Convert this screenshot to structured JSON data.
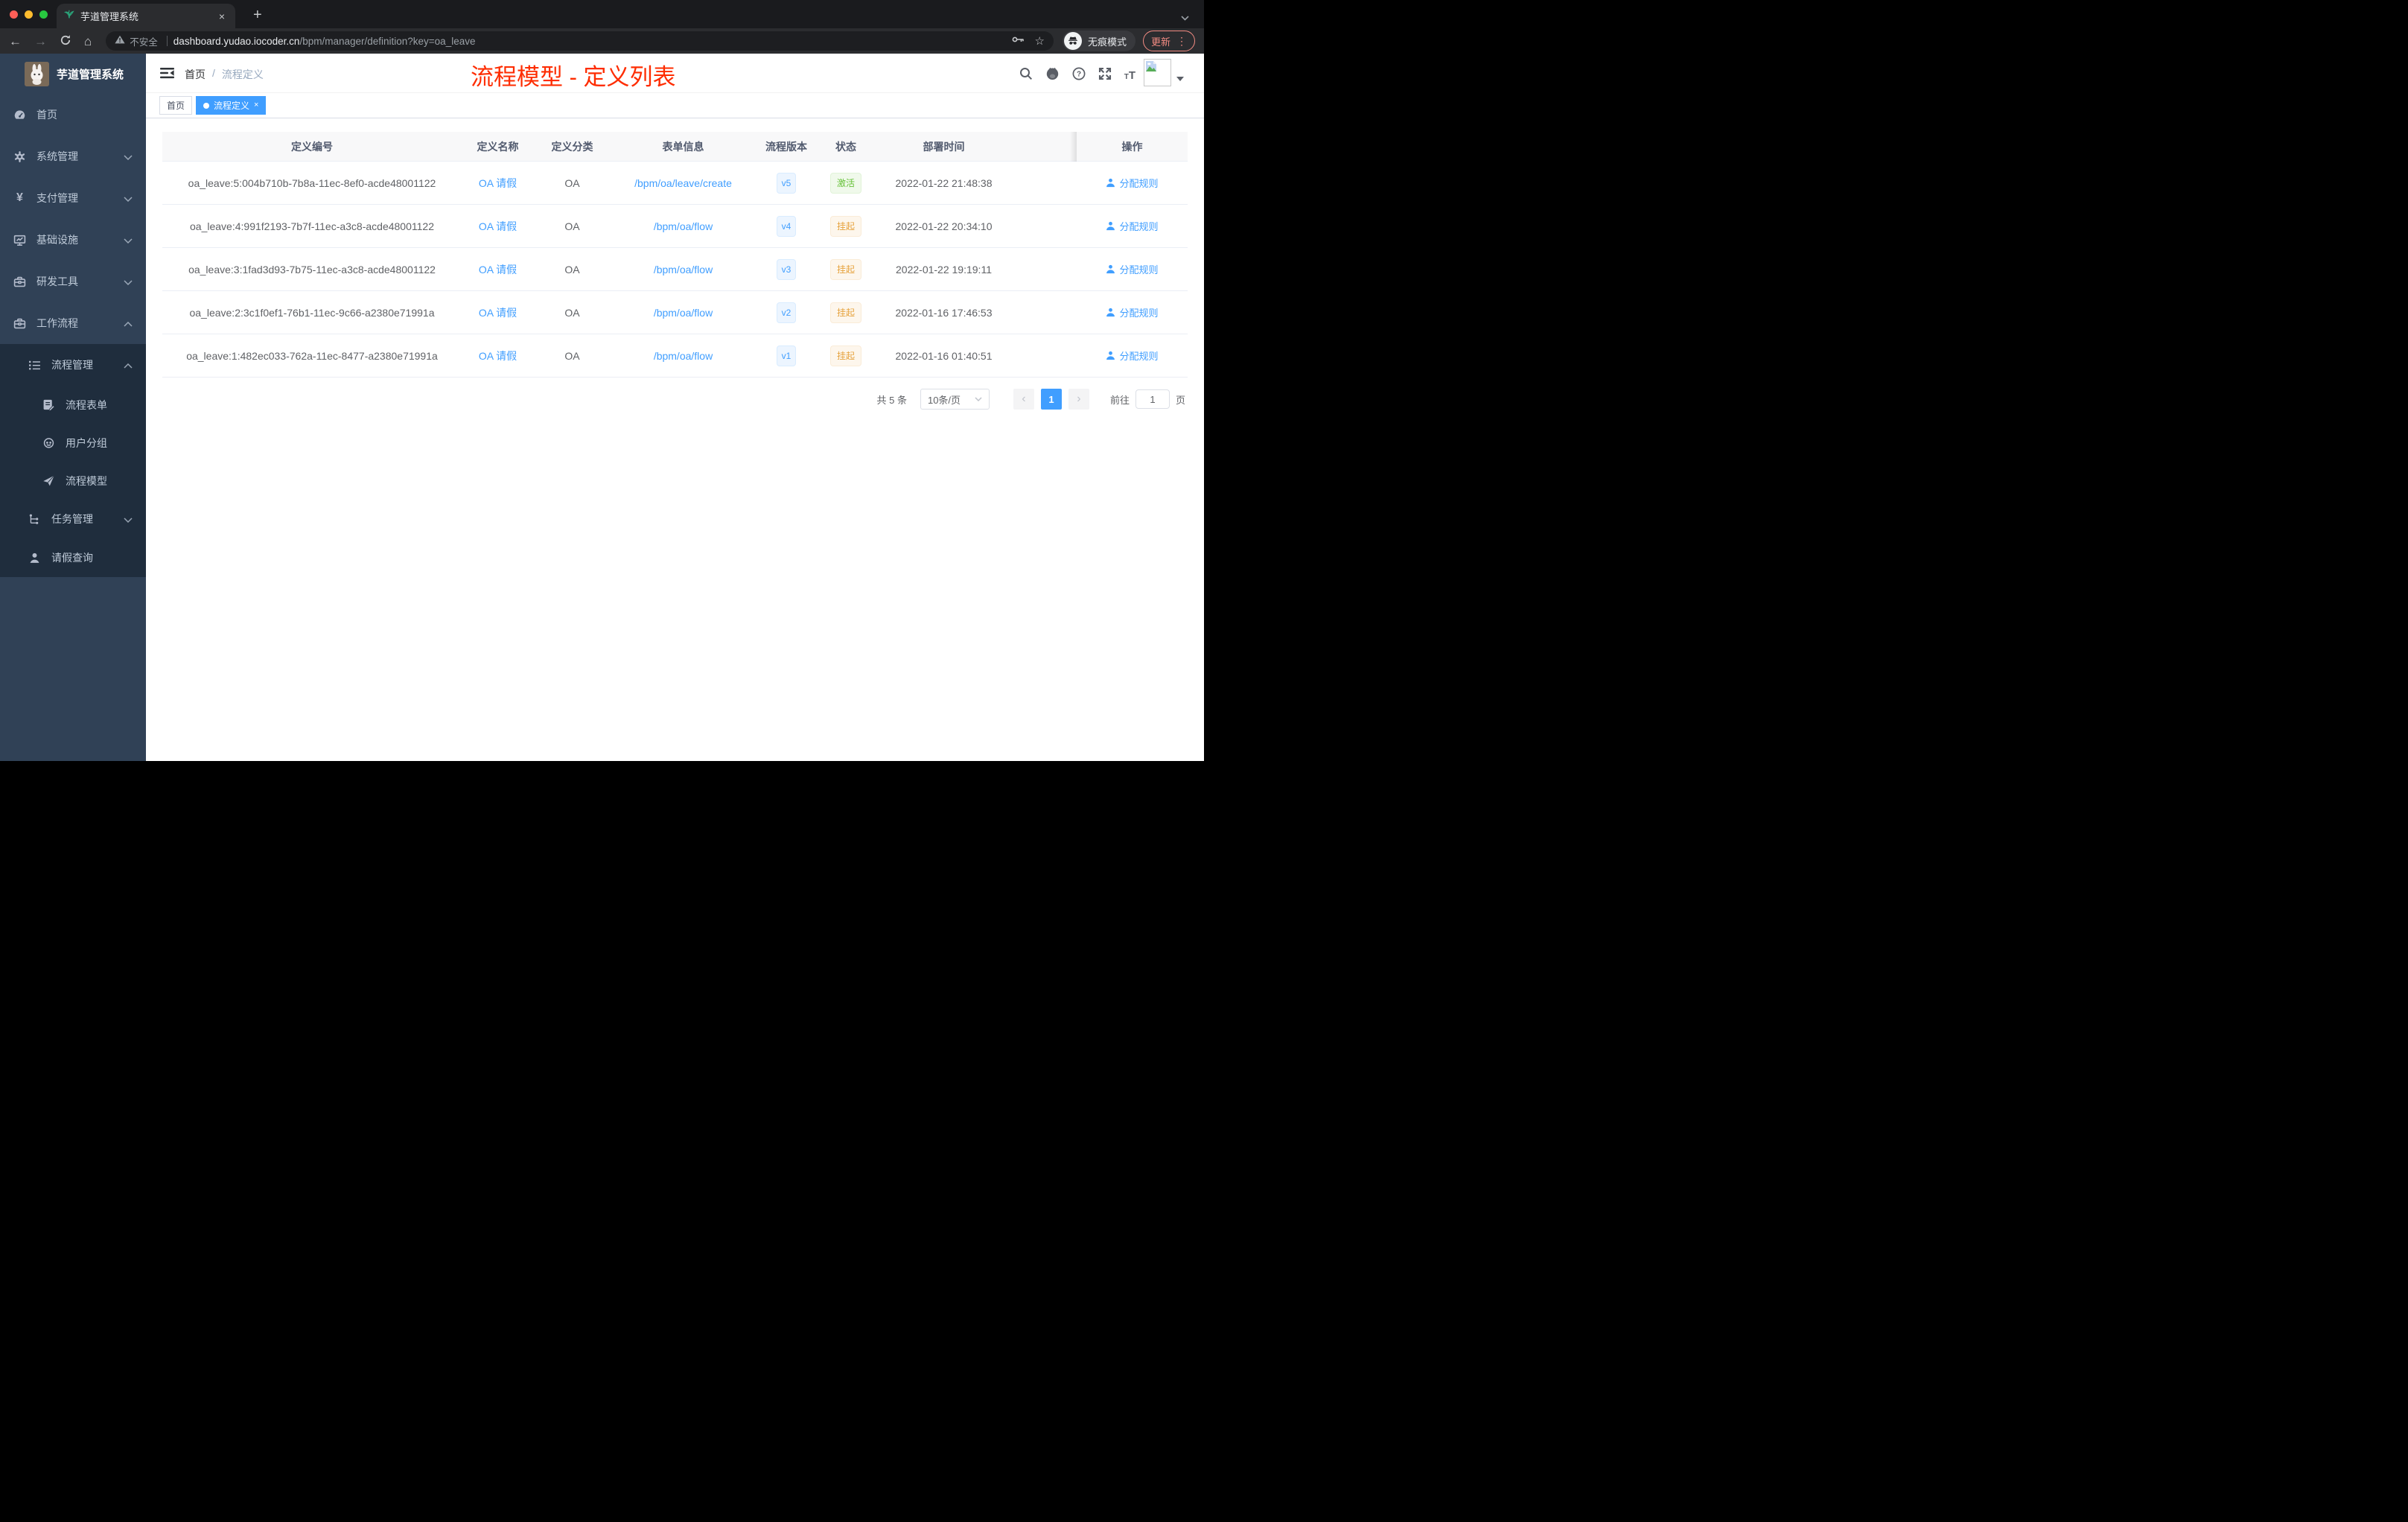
{
  "browser": {
    "tab_title": "芋道管理系统",
    "tab_close": "×",
    "new_tab_label": "+",
    "back_arrow": "←",
    "forward_arrow": "→",
    "home_glyph": "⌂",
    "security_label": "不安全",
    "url_host": "dashboard.yudao.iocoder.cn",
    "url_path": "/bpm/manager/definition?key=oa_leave",
    "star_glyph": "☆",
    "incognito_label": "无痕模式",
    "update_label": "更新",
    "menu_dots": "⋮"
  },
  "sidebar": {
    "logo_title": "芋道管理系统",
    "items": [
      {
        "label": "首页"
      },
      {
        "label": "系统管理"
      },
      {
        "label": "支付管理"
      },
      {
        "label": "基础设施"
      },
      {
        "label": "研发工具"
      },
      {
        "label": "工作流程"
      },
      {
        "label": "流程管理"
      },
      {
        "label": "流程表单"
      },
      {
        "label": "用户分组"
      },
      {
        "label": "流程模型"
      },
      {
        "label": "任务管理"
      },
      {
        "label": "请假查询"
      }
    ],
    "pay_icon_glyph": "¥"
  },
  "navbar": {
    "breadcrumb_home": "首页",
    "breadcrumb_sep": "/",
    "breadcrumb_current": "流程定义",
    "overlay_title": "流程模型 - 定义列表"
  },
  "tags": {
    "home": "首页",
    "active": "流程定义",
    "close": "×"
  },
  "table": {
    "headers": {
      "id": "定义编号",
      "name": "定义名称",
      "category": "定义分类",
      "form": "表单信息",
      "version": "流程版本",
      "status": "状态",
      "deploy_time": "部署时间",
      "actions": "操作"
    },
    "rows": [
      {
        "id": "oa_leave:5:004b710b-7b8a-11ec-8ef0-acde48001122",
        "name": "OA 请假",
        "category": "OA",
        "form": "/bpm/oa/leave/create",
        "version": "v5",
        "status": "激活",
        "deploy_time": "2022-01-22 21:48:38",
        "action": "分配规则"
      },
      {
        "id": "oa_leave:4:991f2193-7b7f-11ec-a3c8-acde48001122",
        "name": "OA 请假",
        "category": "OA",
        "form": "/bpm/oa/flow",
        "version": "v4",
        "status": "挂起",
        "deploy_time": "2022-01-22 20:34:10",
        "action": "分配规则"
      },
      {
        "id": "oa_leave:3:1fad3d93-7b75-11ec-a3c8-acde48001122",
        "name": "OA 请假",
        "category": "OA",
        "form": "/bpm/oa/flow",
        "version": "v3",
        "status": "挂起",
        "deploy_time": "2022-01-22 19:19:11",
        "action": "分配规则"
      },
      {
        "id": "oa_leave:2:3c1f0ef1-76b1-11ec-9c66-a2380e71991a",
        "name": "OA 请假",
        "category": "OA",
        "form": "/bpm/oa/flow",
        "version": "v2",
        "status": "挂起",
        "deploy_time": "2022-01-16 17:46:53",
        "action": "分配规则"
      },
      {
        "id": "oa_leave:1:482ec033-762a-11ec-8477-a2380e71991a",
        "name": "OA 请假",
        "category": "OA",
        "form": "/bpm/oa/flow",
        "version": "v1",
        "status": "挂起",
        "deploy_time": "2022-01-16 01:40:51",
        "action": "分配规则"
      }
    ]
  },
  "pagination": {
    "total": "共 5 条",
    "page_size": "10条/页",
    "prev": "‹",
    "page": "1",
    "next": "›",
    "goto_label": "前往",
    "goto_value": "1",
    "page_unit": "页"
  },
  "colors": {
    "accent_blue": "#409EFF",
    "sidebar_bg": "#304156",
    "submenu_bg": "#1F2D3D",
    "overlay_red": "#FE2C00",
    "status_active": "#67C23A",
    "status_suspended": "#E6A23C",
    "update_salmon": "#F28B82"
  }
}
